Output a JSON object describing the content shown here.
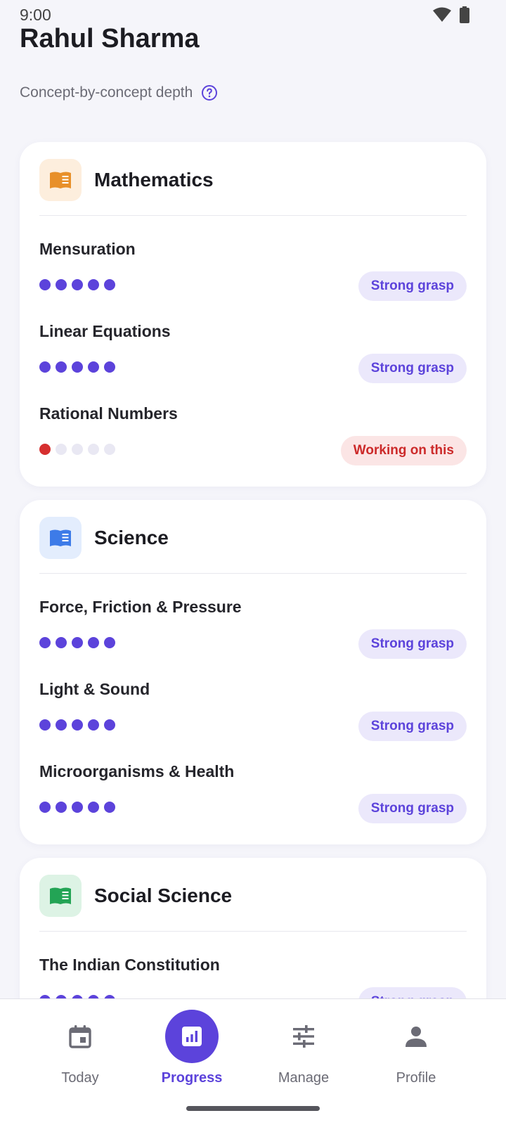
{
  "status_bar": {
    "time": "9:00"
  },
  "header": {
    "name": "Rahul Sharma",
    "subtitle": "Concept-by-concept depth"
  },
  "colors": {
    "accent": "#5c43db",
    "strong_bg": "#ebe8fb",
    "working_text": "#cc2a2a",
    "working_bg": "#fbe5e5"
  },
  "subjects": [
    {
      "title": "Mathematics",
      "icon": "book-icon",
      "icon_color": "#e8902a",
      "icon_bg": "#fdeedd",
      "concepts": [
        {
          "name": "Mensuration",
          "level": 5,
          "status": "Strong grasp"
        },
        {
          "name": "Linear Equations",
          "level": 5,
          "status": "Strong grasp"
        },
        {
          "name": "Rational Numbers",
          "level": 1,
          "status": "Working on this"
        }
      ]
    },
    {
      "title": "Science",
      "icon": "book-icon",
      "icon_color": "#3d7be8",
      "icon_bg": "#e3edfd",
      "concepts": [
        {
          "name": "Force, Friction & Pressure",
          "level": 5,
          "status": "Strong grasp"
        },
        {
          "name": "Light & Sound",
          "level": 5,
          "status": "Strong grasp"
        },
        {
          "name": "Microorganisms & Health",
          "level": 5,
          "status": "Strong grasp"
        }
      ]
    },
    {
      "title": "Social Science",
      "icon": "book-icon",
      "icon_color": "#23a455",
      "icon_bg": "#ddf3e5",
      "concepts": [
        {
          "name": "The Indian Constitution",
          "level": 5,
          "status": "Strong grasp"
        }
      ]
    }
  ],
  "bottom_nav": [
    {
      "label": "Today",
      "icon": "calendar-icon",
      "active": false
    },
    {
      "label": "Progress",
      "icon": "bar-chart-icon",
      "active": true
    },
    {
      "label": "Manage",
      "icon": "sliders-icon",
      "active": false
    },
    {
      "label": "Profile",
      "icon": "person-icon",
      "active": false
    }
  ]
}
